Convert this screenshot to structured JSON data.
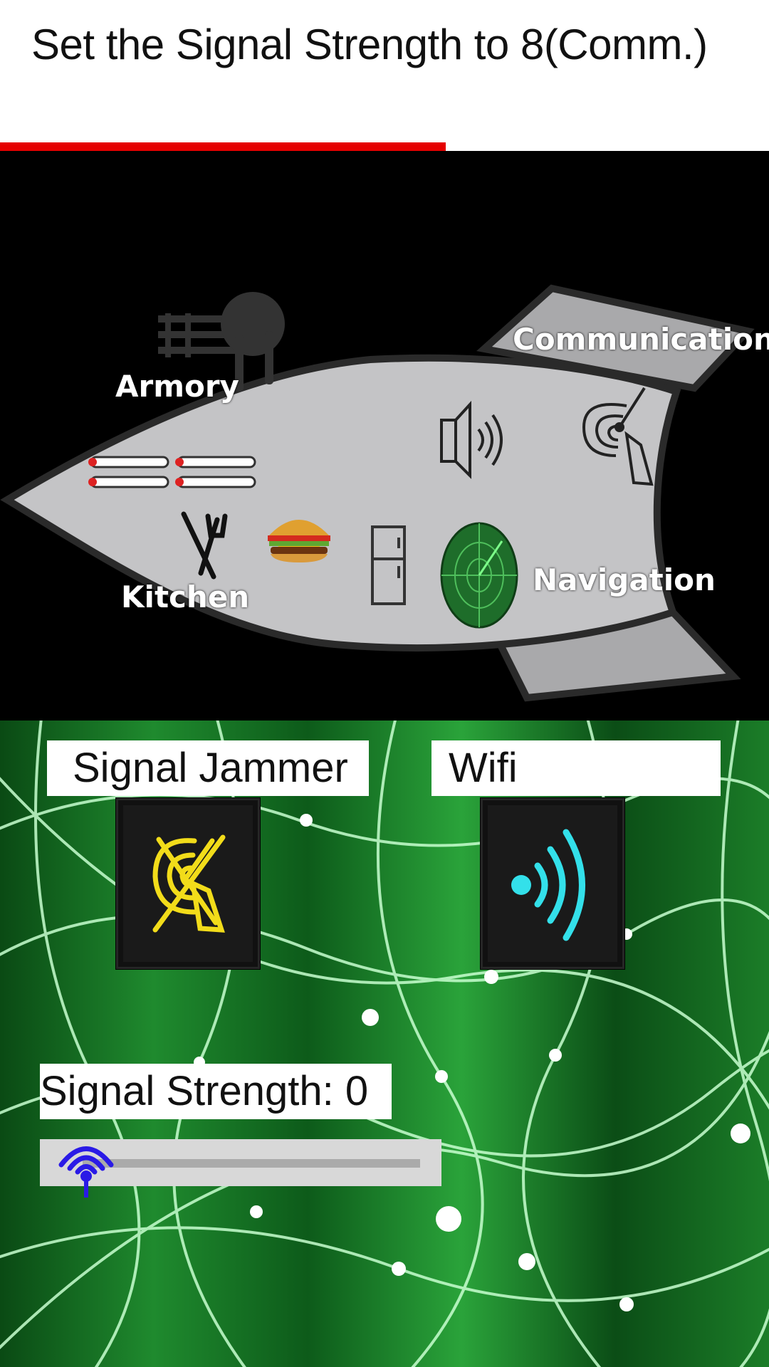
{
  "task": {
    "instruction": "Set the Signal Strength to  8(Comm.)",
    "timer_remaining_fraction": 0.58
  },
  "ship": {
    "rooms": {
      "armory": "Armory",
      "communication": "Communication",
      "kitchen": "Kitchen",
      "navigation": "Navigation"
    }
  },
  "controls": {
    "signal_jammer_label": "Signal Jammer",
    "wifi_label": "Wifi",
    "signal_strength_prefix": "Signal Strength: ",
    "signal_strength_value": 0,
    "signal_strength_text": "Signal Strength: 0",
    "slider_fraction": 0.0
  },
  "colors": {
    "timer": "#e50000",
    "jammer_icon": "#f2dc1a",
    "wifi_icon": "#33e0ea",
    "slider_thumb": "#2a1ae6",
    "ship_hull": "#c4c4c6"
  },
  "icons": [
    "cannon-icon",
    "missile-icon",
    "fork-knife-icon",
    "burger-icon",
    "fridge-icon",
    "speaker-icon",
    "satellite-dish-icon",
    "radar-icon",
    "jammer-icon",
    "wifi-icon",
    "signal-thumb-icon"
  ]
}
